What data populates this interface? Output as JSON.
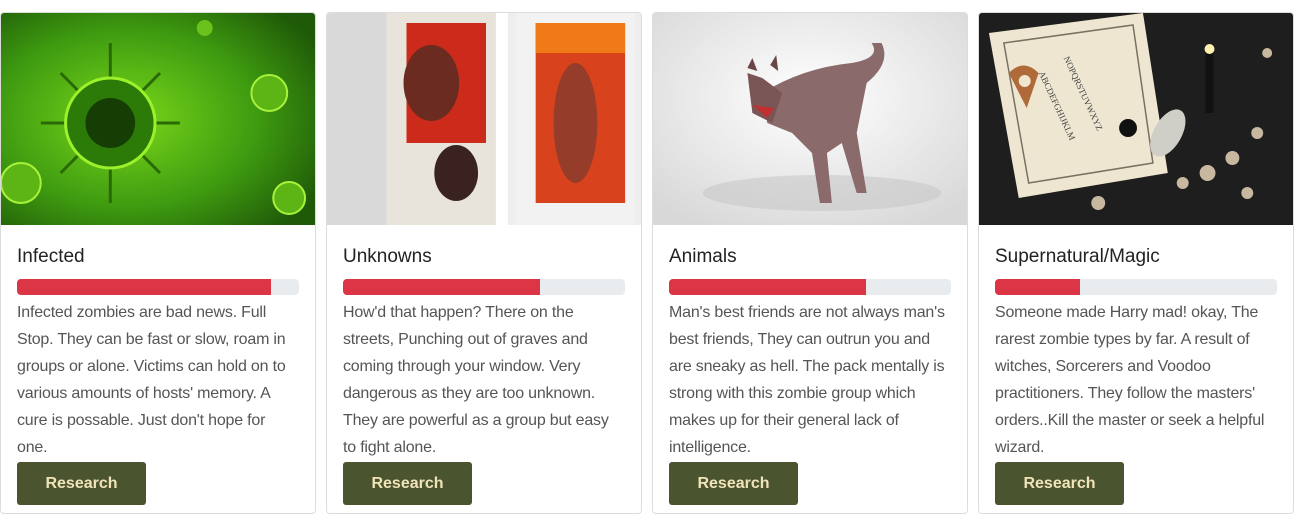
{
  "colors": {
    "progress_fill": "#dc3545",
    "progress_track": "#e9ecef",
    "button_bg": "#4a5530",
    "button_text": "#f0e3b8"
  },
  "cards": [
    {
      "title": "Infected",
      "threat_level": 0.9,
      "text": "Infected zombies are bad news. Full Stop. They can be fast or slow, roam in groups or alone. Victims can hold on to various amounts of hosts' memory. A cure is possable. Just don't hope for one.",
      "button_label": "Research",
      "image": "virus-image"
    },
    {
      "title": "Unknowns",
      "threat_level": 0.7,
      "text": "How'd that happen? There on the streets, Punching out of graves and coming through your window. Very dangerous as they are too unknown. They are powerful as a group but easy to fight alone.",
      "button_label": "Research",
      "image": "zombies-window-image"
    },
    {
      "title": "Animals",
      "threat_level": 0.7,
      "text": "Man's best friends are not always man's best friends, They can outrun you and are sneaky as hell. The pack mentally is strong with this zombie group which makes up for their general lack of intelligence.",
      "button_label": "Research",
      "image": "zombie-dog-image"
    },
    {
      "title": "Supernatural/Magic",
      "threat_level": 0.3,
      "text": "Someone made Harry mad! okay, The rarest zombie types by far. A result of witches, Sorcerers and Voodoo practitioners. They follow the masters' orders..Kill the master or seek a helpful wizard.",
      "button_label": "Research",
      "image": "ouija-board-image"
    }
  ]
}
